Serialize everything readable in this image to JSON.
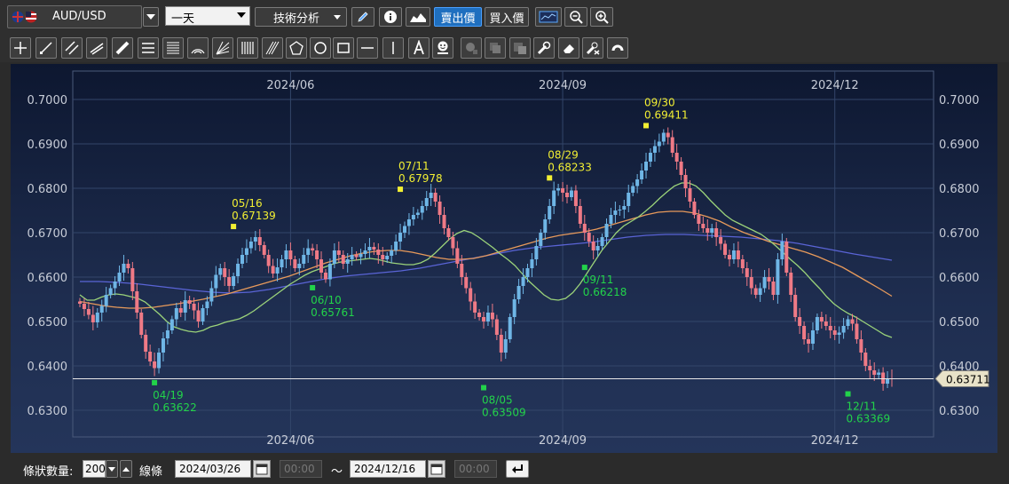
{
  "toolbar": {
    "symbol": "AUD/USD",
    "period": "一天",
    "analysis": "技術分析",
    "sell_label": "賣出價",
    "buy_label": "買入價"
  },
  "bottom": {
    "count_label": "條狀數量:",
    "count_value": "200",
    "line_label": "線條",
    "start_date": "2024/03/26",
    "start_time": "00:00",
    "tilde": "～",
    "end_date": "2024/12/16",
    "end_time": "00:00"
  },
  "chart_data": {
    "type": "candlestick",
    "ylim": [
      0.627,
      0.704
    ],
    "yticks": [
      "0.7000",
      "0.6900",
      "0.6800",
      "0.6700",
      "0.6600",
      "0.6500",
      "0.6400",
      "0.6300"
    ],
    "xticks": [
      "2024/06",
      "2024/09",
      "2024/12"
    ],
    "current_price": "0.63711",
    "colors": {
      "up": "#6fb6e6",
      "down": "#ef7a86",
      "ma_short": "#9bd37a",
      "ma_mid": "#e89a5b",
      "ma_long": "#5a64d6",
      "high_marker": "#f2ef33",
      "low_marker": "#22d34a"
    },
    "annotations": [
      {
        "kind": "high",
        "date": "05/16",
        "value": "0.67139"
      },
      {
        "kind": "high",
        "date": "07/11",
        "value": "0.67978"
      },
      {
        "kind": "high",
        "date": "08/29",
        "value": "0.68233"
      },
      {
        "kind": "high",
        "date": "09/30",
        "value": "0.69411"
      },
      {
        "kind": "low",
        "date": "04/19",
        "value": "0.63622"
      },
      {
        "kind": "low",
        "date": "06/10",
        "value": "0.65761"
      },
      {
        "kind": "low",
        "date": "08/05",
        "value": "0.63509"
      },
      {
        "kind": "low",
        "date": "09/11",
        "value": "0.66218"
      },
      {
        "kind": "low",
        "date": "12/11",
        "value": "0.63369"
      }
    ],
    "closes": [
      0.654,
      0.6528,
      0.6515,
      0.6498,
      0.652,
      0.6535,
      0.656,
      0.6575,
      0.659,
      0.661,
      0.663,
      0.662,
      0.6568,
      0.652,
      0.647,
      0.6432,
      0.641,
      0.6395,
      0.643,
      0.6462,
      0.648,
      0.6505,
      0.653,
      0.652,
      0.6548,
      0.654,
      0.6525,
      0.65,
      0.653,
      0.6545,
      0.6575,
      0.6605,
      0.662,
      0.66,
      0.658,
      0.6602,
      0.663,
      0.665,
      0.6665,
      0.668,
      0.669,
      0.6672,
      0.665,
      0.6625,
      0.6608,
      0.6622,
      0.664,
      0.666,
      0.664,
      0.662,
      0.663,
      0.665,
      0.6665,
      0.666,
      0.664,
      0.661,
      0.6595,
      0.663,
      0.666,
      0.665,
      0.663,
      0.664,
      0.665,
      0.6645,
      0.6652,
      0.666,
      0.6668,
      0.6662,
      0.665,
      0.664,
      0.6648,
      0.666,
      0.668,
      0.67,
      0.6715,
      0.673,
      0.674,
      0.6745,
      0.676,
      0.6778,
      0.679,
      0.677,
      0.674,
      0.671,
      0.669,
      0.6665,
      0.663,
      0.66,
      0.6575,
      0.6545,
      0.652,
      0.651,
      0.65,
      0.652,
      0.6505,
      0.647,
      0.643,
      0.646,
      0.651,
      0.655,
      0.658,
      0.66,
      0.662,
      0.664,
      0.667,
      0.67,
      0.673,
      0.676,
      0.6795,
      0.68,
      0.679,
      0.678,
      0.6795,
      0.676,
      0.672,
      0.67,
      0.668,
      0.666,
      0.667,
      0.669,
      0.672,
      0.674,
      0.675,
      0.6752,
      0.676,
      0.679,
      0.6805,
      0.682,
      0.684,
      0.686,
      0.688,
      0.6895,
      0.6905,
      0.6925,
      0.6915,
      0.688,
      0.686,
      0.683,
      0.68,
      0.677,
      0.674,
      0.672,
      0.671,
      0.67,
      0.671,
      0.669,
      0.6675,
      0.665,
      0.664,
      0.666,
      0.664,
      0.662,
      0.66,
      0.6575,
      0.656,
      0.6575,
      0.66,
      0.659,
      0.656,
      0.664,
      0.668,
      0.661,
      0.656,
      0.651,
      0.649,
      0.646,
      0.645,
      0.648,
      0.651,
      0.65,
      0.649,
      0.648,
      0.647,
      0.6475,
      0.649,
      0.6505,
      0.6495,
      0.646,
      0.643,
      0.64,
      0.639,
      0.638,
      0.6385,
      0.636,
      0.6372,
      0.6371
    ],
    "ma_short": [
      0.656,
      0.6548,
      0.6548,
      0.6555,
      0.656,
      0.6562,
      0.656,
      0.6556,
      0.6552,
      0.6544,
      0.653,
      0.6516,
      0.65,
      0.6488,
      0.6482,
      0.6478,
      0.6476,
      0.648,
      0.6488,
      0.6492,
      0.6498,
      0.6502,
      0.6506,
      0.6514,
      0.6524,
      0.6536,
      0.6548,
      0.656,
      0.6572,
      0.6584,
      0.6594,
      0.6604,
      0.6612,
      0.6618,
      0.6624,
      0.663,
      0.6634,
      0.6636,
      0.6638,
      0.664,
      0.6642,
      0.664,
      0.6636,
      0.6632,
      0.663,
      0.6628,
      0.6628,
      0.6632,
      0.664,
      0.6654,
      0.667,
      0.6686,
      0.6698,
      0.6705,
      0.67,
      0.669,
      0.6678,
      0.6666,
      0.6652,
      0.664,
      0.6626,
      0.6608,
      0.659,
      0.6575,
      0.656,
      0.655,
      0.6548,
      0.6552,
      0.6565,
      0.6585,
      0.661,
      0.6635,
      0.666,
      0.668,
      0.67,
      0.6715,
      0.6725,
      0.6735,
      0.6748,
      0.6762,
      0.6778,
      0.6792,
      0.6805,
      0.6812,
      0.6812,
      0.6805,
      0.679,
      0.6772,
      0.6756,
      0.674,
      0.6728,
      0.672,
      0.6712,
      0.6704,
      0.6696,
      0.6684,
      0.667,
      0.6655,
      0.664,
      0.6626,
      0.661,
      0.6592,
      0.6575,
      0.6556,
      0.654,
      0.6528,
      0.6518,
      0.651,
      0.65,
      0.649,
      0.648,
      0.647,
      0.6464
    ],
    "ma_mid": [
      0.6545,
      0.654,
      0.6535,
      0.6532,
      0.653,
      0.653,
      0.6532,
      0.6536,
      0.654,
      0.6545,
      0.655,
      0.6556,
      0.6562,
      0.657,
      0.6578,
      0.6586,
      0.6594,
      0.6602,
      0.6612,
      0.6622,
      0.6632,
      0.664,
      0.6648,
      0.6654,
      0.6658,
      0.666,
      0.666,
      0.6656,
      0.665,
      0.6644,
      0.664,
      0.664,
      0.6642,
      0.6648,
      0.6656,
      0.6664,
      0.6672,
      0.668,
      0.6688,
      0.6694,
      0.6698,
      0.6702,
      0.6708,
      0.6716,
      0.6724,
      0.6732,
      0.674,
      0.6746,
      0.6748,
      0.6748,
      0.6744,
      0.6736,
      0.6726,
      0.6712,
      0.67,
      0.669,
      0.668,
      0.6672,
      0.6664,
      0.6656,
      0.6646,
      0.6634,
      0.6622,
      0.6606,
      0.659,
      0.6574,
      0.6557
    ],
    "ma_long": [
      0.659,
      0.659,
      0.6588,
      0.6585,
      0.658,
      0.6575,
      0.657,
      0.6566,
      0.6564,
      0.6566,
      0.6572,
      0.658,
      0.6588,
      0.6596,
      0.6602,
      0.6606,
      0.661,
      0.6614,
      0.662,
      0.6628,
      0.6636,
      0.6644,
      0.6652,
      0.666,
      0.6666,
      0.667,
      0.6674,
      0.6678,
      0.6684,
      0.669,
      0.6694,
      0.6696,
      0.6696,
      0.6694,
      0.6692,
      0.669,
      0.6686,
      0.6682,
      0.6676,
      0.6668,
      0.666,
      0.6652,
      0.6645,
      0.6638
    ]
  }
}
